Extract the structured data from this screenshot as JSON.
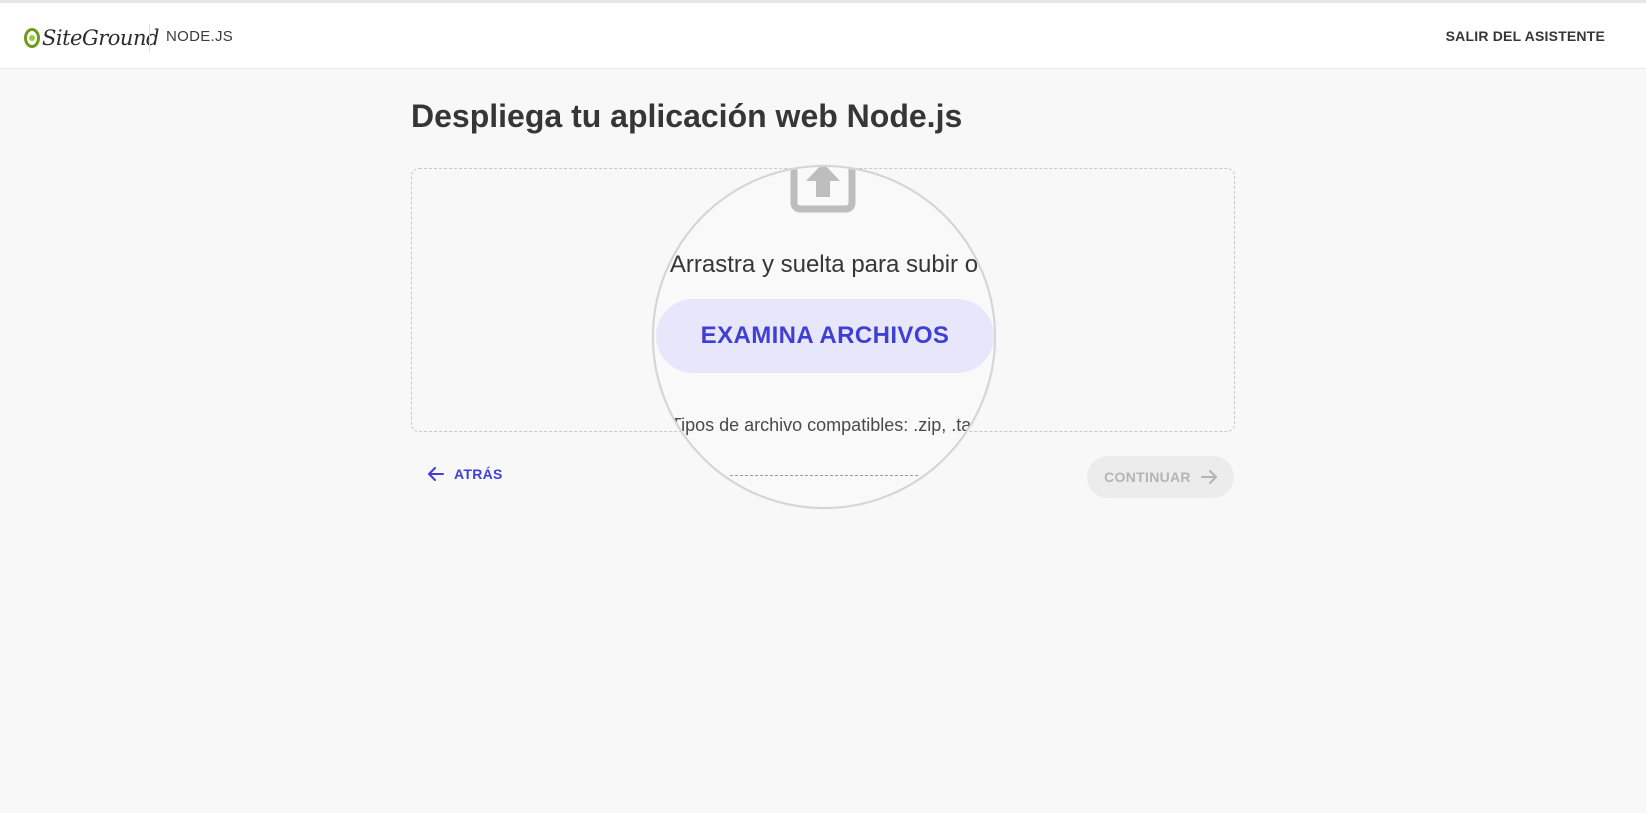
{
  "header": {
    "logo_text": "SiteGround",
    "product": "NODE.JS",
    "exit_label": "SALIR DEL ASISTENTE"
  },
  "main": {
    "title": "Despliega tu aplicación web Node.js",
    "upload": {
      "drag_text": "Arrastra y suelta para subir o",
      "browse_label": "EXAMINA ARCHIVOS",
      "formats_text": "Tipos de archivo compatibles: .zip, .tar"
    }
  },
  "footer": {
    "back_label": "ATRÁS",
    "continue_label": "CONTINUAR"
  },
  "icons": {
    "logo": "siteground-logo-icon",
    "upload": "upload-icon",
    "back": "arrow-left-icon",
    "continue": "arrow-right-icon"
  },
  "colors": {
    "accent": "#3f3fd4",
    "accent_bg": "#e8e6fb",
    "disabled_bg": "#ececec",
    "disabled_text": "#b4b4b4",
    "logo_green": "#6e9a1e"
  }
}
